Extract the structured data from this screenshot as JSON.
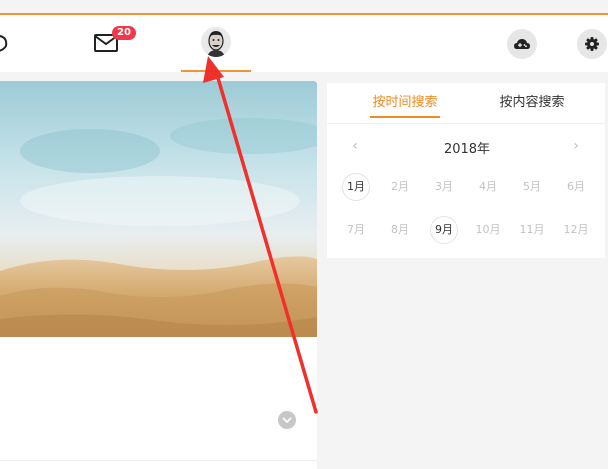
{
  "header": {
    "mail_badge_count": "20",
    "icons": [
      "leaf-icon",
      "mail-icon",
      "avatar",
      "cloud-gamepad-icon",
      "gear-icon"
    ]
  },
  "colors": {
    "accent": "#f19434",
    "tab_active": "#f08a24",
    "badge": "#f0374b",
    "page_background": "#f4f4f4",
    "annotation_arrow": "#f0302a"
  },
  "search_panel": {
    "tabs": [
      {
        "label": "按时间搜索",
        "active": true
      },
      {
        "label": "按内容搜索",
        "active": false
      }
    ],
    "year": "2018年",
    "months": [
      {
        "label": "1月",
        "state": "active"
      },
      {
        "label": "2月",
        "state": "disabled"
      },
      {
        "label": "3月",
        "state": "disabled"
      },
      {
        "label": "4月",
        "state": "disabled"
      },
      {
        "label": "5月",
        "state": "disabled"
      },
      {
        "label": "6月",
        "state": "disabled"
      },
      {
        "label": "7月",
        "state": "disabled"
      },
      {
        "label": "8月",
        "state": "disabled"
      },
      {
        "label": "9月",
        "state": "active"
      },
      {
        "label": "10月",
        "state": "disabled"
      },
      {
        "label": "11月",
        "state": "disabled"
      },
      {
        "label": "12月",
        "state": "disabled"
      }
    ]
  }
}
